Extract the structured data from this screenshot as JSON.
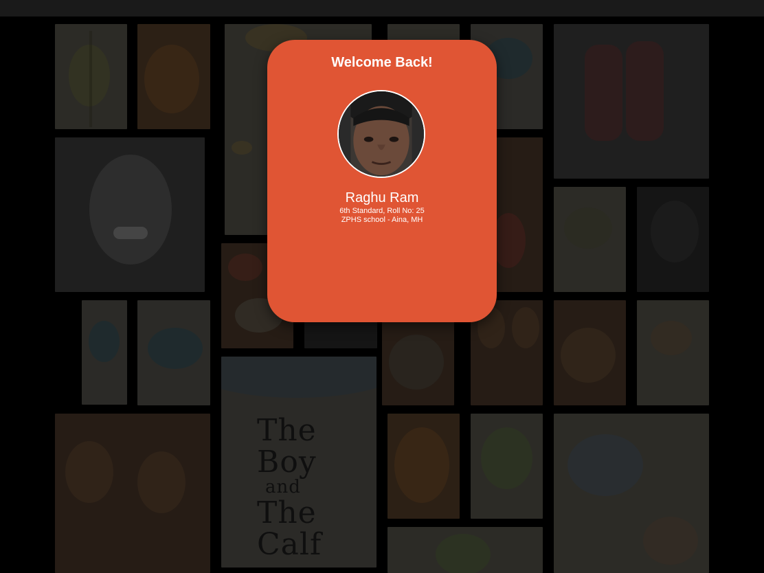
{
  "card": {
    "title": "Welcome Back!",
    "student_name": "Raghu Ram",
    "class_info": "6th Standard, Roll No: 25",
    "school": "ZPHS school - Aina, MH"
  },
  "background": {
    "book_title_lines": [
      "The",
      "Boy",
      "and",
      "The",
      "Calf"
    ]
  },
  "colors": {
    "card": "#e05534",
    "topbar": "#1a1a1a",
    "page_bg": "#000000"
  },
  "icons": {
    "avatar": "student-photo"
  }
}
